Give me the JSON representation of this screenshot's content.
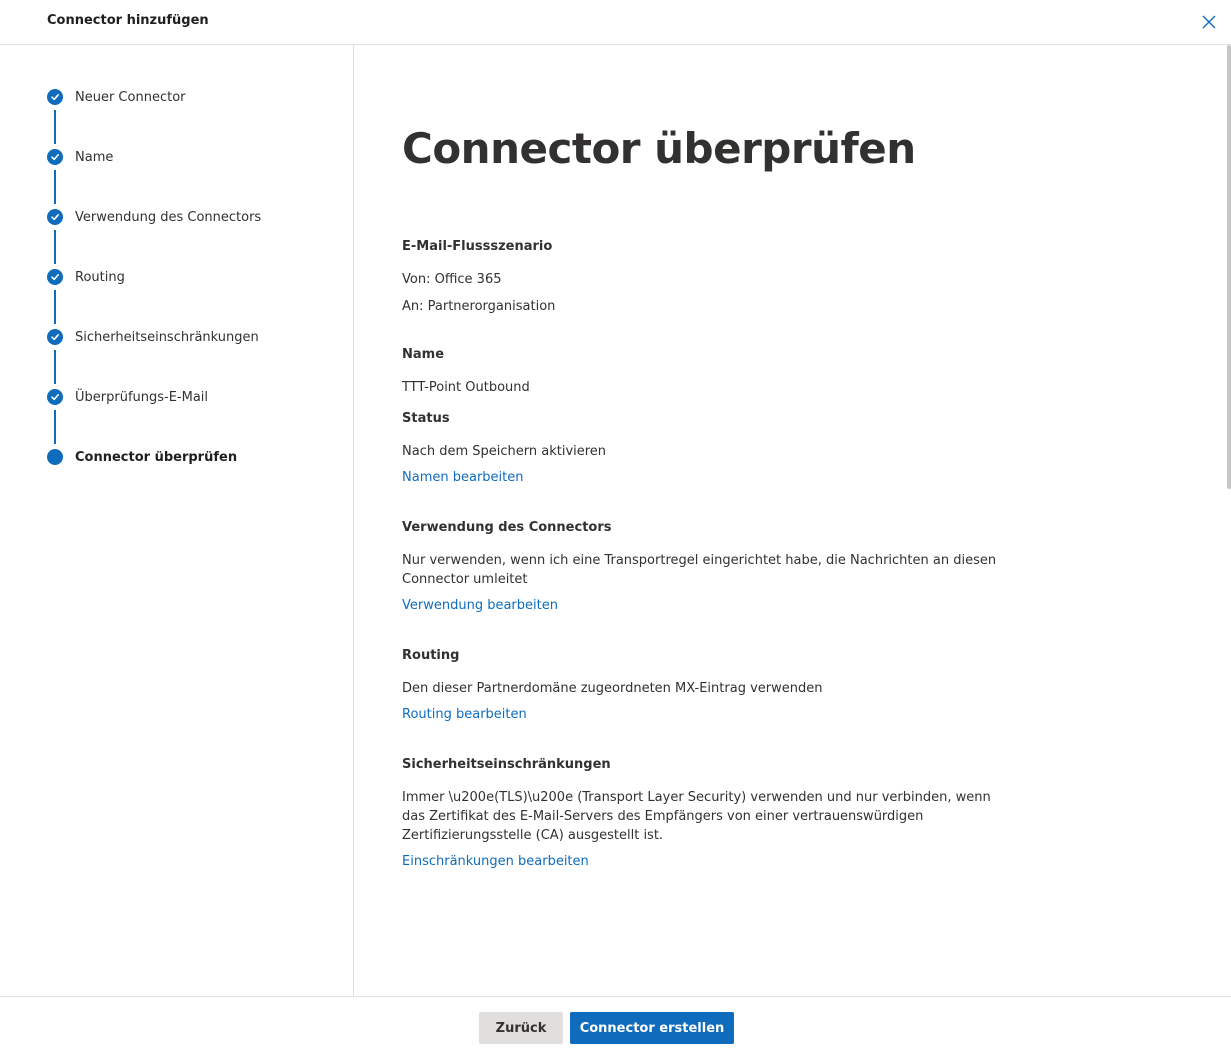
{
  "header": {
    "title": "Connector hinzufügen",
    "close_icon": "close-icon"
  },
  "steps": [
    {
      "label": "Neuer Connector",
      "state": "done"
    },
    {
      "label": "Name",
      "state": "done"
    },
    {
      "label": "Verwendung des Connectors",
      "state": "done"
    },
    {
      "label": "Routing",
      "state": "done"
    },
    {
      "label": "Sicherheitseinschränkungen",
      "state": "done"
    },
    {
      "label": "Überprüfungs-E-Mail",
      "state": "done"
    },
    {
      "label": "Connector überprüfen",
      "state": "current"
    }
  ],
  "main": {
    "title": "Connector überprüfen",
    "mailflow": {
      "heading": "E-Mail-Flussszenario",
      "from": "Von: Office 365",
      "to": "An: Partnerorganisation"
    },
    "name": {
      "heading": "Name",
      "value": "TTT-Point Outbound",
      "status_heading": "Status",
      "status_value": "Nach dem Speichern aktivieren",
      "edit_link": "Namen bearbeiten"
    },
    "usage": {
      "heading": "Verwendung des Connectors",
      "value": "Nur verwenden, wenn ich eine Transportregel eingerichtet habe, die Nachrichten an diesen Connector umleitet",
      "edit_link": "Verwendung bearbeiten"
    },
    "routing": {
      "heading": "Routing",
      "value": "Den dieser Partnerdomäne zugeordneten MX-Eintrag verwenden",
      "edit_link": "Routing bearbeiten"
    },
    "security": {
      "heading": "Sicherheitseinschränkungen",
      "value": "Immer \\u200e(TLS)\\u200e (Transport Layer Security) verwenden und nur verbinden, wenn das Zertifikat des E-Mail-Servers des Empfängers von einer vertrauenswürdigen Zertifizierungsstelle (CA) ausgestellt ist.",
      "edit_link": "Einschränkungen bearbeiten"
    }
  },
  "footer": {
    "back_label": "Zurück",
    "create_label": "Connector erstellen"
  },
  "colors": {
    "accent": "#0f6cbd",
    "text": "#323130",
    "border": "#e1dfdd",
    "secondary_button": "#e1dfdd"
  }
}
